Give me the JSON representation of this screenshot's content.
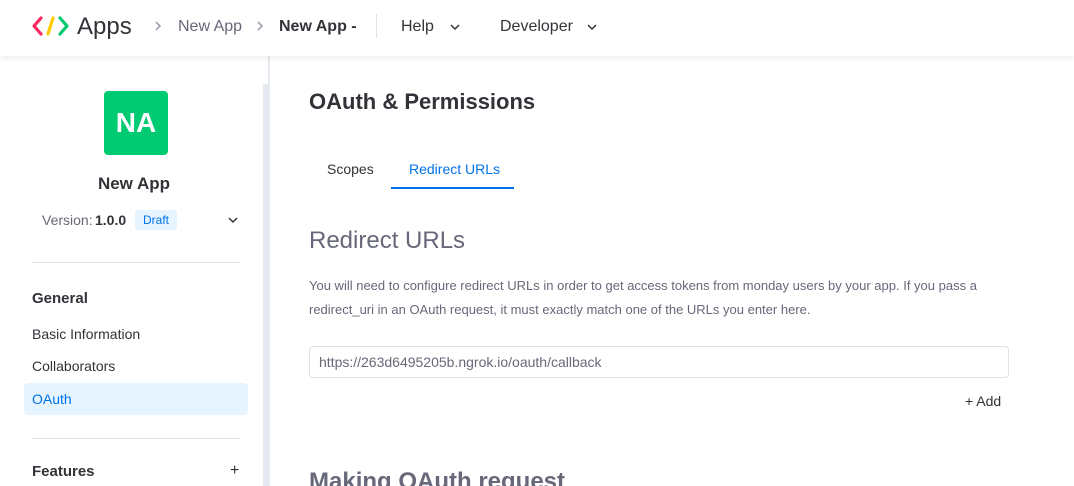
{
  "header": {
    "app_title": "Apps",
    "breadcrumbs": [
      {
        "label": "New App"
      },
      {
        "label": "New App -"
      }
    ],
    "menus": [
      {
        "label": "Help"
      },
      {
        "label": "Developer"
      }
    ]
  },
  "sidebar": {
    "avatar_initials": "NA",
    "app_name": "New App",
    "version_label": "Version:",
    "version_value": "1.0.0",
    "status_badge": "Draft",
    "general_heading": "General",
    "items": [
      {
        "label": "Basic Information"
      },
      {
        "label": "Collaborators"
      },
      {
        "label": "OAuth"
      }
    ],
    "features_heading": "Features",
    "features_add": "+"
  },
  "main": {
    "page_title": "OAuth & Permissions",
    "tabs": [
      {
        "label": "Scopes"
      },
      {
        "label": "Redirect URLs"
      }
    ],
    "section_title": "Redirect URLs",
    "description": "You will need to configure redirect URLs in order to get access tokens from monday users by your app. If you pass a redirect_uri in an OAuth request, it must exactly match one of the URLs you enter here.",
    "redirect_url_value": "https://263d6495205b.ngrok.io/oauth/callback",
    "add_label": "+ Add",
    "next_section_title": "Making OAuth request"
  },
  "colors": {
    "accent": "#0073ea",
    "avatar": "#00ca72",
    "active_bg": "#e5f4ff"
  }
}
